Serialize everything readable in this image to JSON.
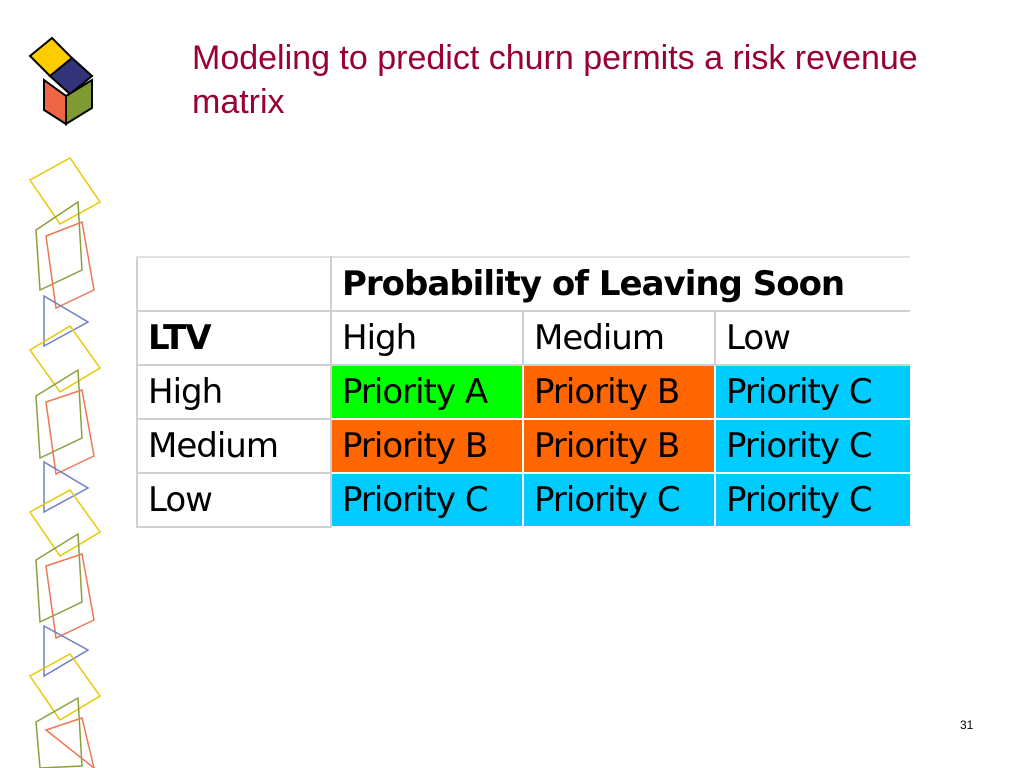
{
  "slide": {
    "title": "Modeling to predict churn permits a risk revenue matrix",
    "page_number": "31"
  },
  "matrix": {
    "header_label": "Probability of Leaving Soon",
    "row_axis_label": "LTV",
    "columns": [
      "High",
      "Medium",
      "Low"
    ],
    "rows": [
      {
        "label": "High",
        "cells": [
          "Priority A",
          "Priority B",
          "Priority C"
        ]
      },
      {
        "label": "Medium",
        "cells": [
          "Priority B",
          "Priority B",
          "Priority C"
        ]
      },
      {
        "label": "Low",
        "cells": [
          "Priority C",
          "Priority C",
          "Priority C"
        ]
      }
    ]
  },
  "colors": {
    "title": "#990033",
    "priority_a": "#00ff00",
    "priority_b": "#ff6600",
    "priority_c": "#00ccff",
    "grid": "#d0d0d0"
  },
  "icons": {
    "logo": "colored-cube-icon",
    "decoration": "geometric-outline-shapes"
  }
}
